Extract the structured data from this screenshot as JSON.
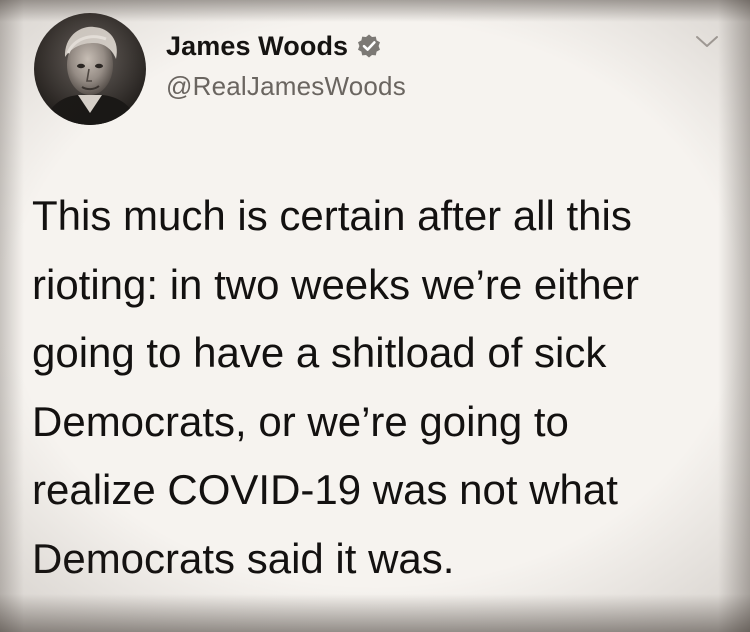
{
  "author": {
    "display_name": "James Woods",
    "handle": "@RealJamesWoods",
    "verified": true,
    "avatar_icon": "profile-photo",
    "verified_icon": "verified-badge-icon",
    "menu_icon": "chevron-down-icon"
  },
  "tweet": {
    "lines": [
      "This much is certain after all this",
      "rioting: in two weeks we’re either",
      "going to have a shitload of sick",
      "Democrats, or we’re going to",
      "realize COVID-19 was not what",
      "Democrats said it was."
    ]
  },
  "colors": {
    "background": "#f6f3ef",
    "text": "#151311",
    "handle": "#6a6560",
    "verified_badge": "#7c7975"
  }
}
